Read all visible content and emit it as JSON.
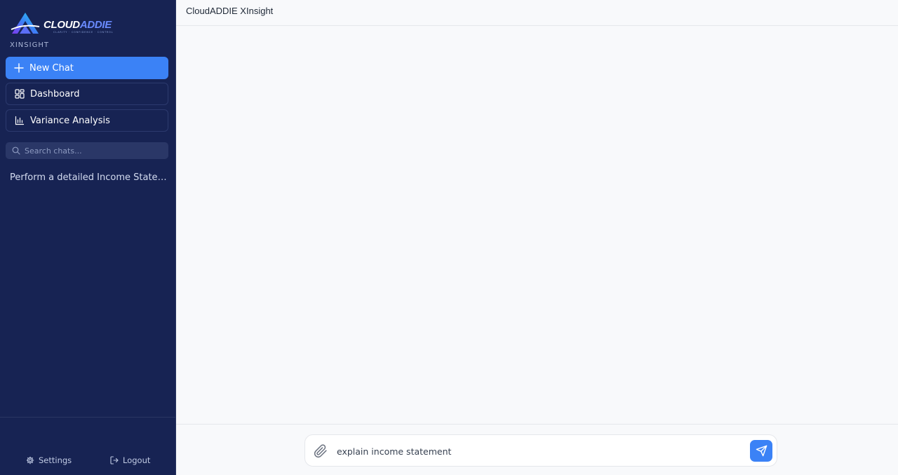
{
  "brand": {
    "logo_text_main": "CLOUD",
    "logo_text_accent": "ADDIE",
    "logo_tagline": "CLARITY · CONFIDENCE · CONTROL",
    "subtitle": "XINSIGHT"
  },
  "sidebar": {
    "new_chat_label": "New Chat",
    "dashboard_label": "Dashboard",
    "variance_label": "Variance Analysis",
    "search_placeholder": "Search chats...",
    "history": [
      "Perform a detailed Income Statement analysis"
    ],
    "settings_label": "Settings",
    "logout_label": "Logout"
  },
  "header": {
    "title": "CloudADDIE XInsight"
  },
  "composer": {
    "value": "explain income statement"
  },
  "colors": {
    "sidebar_bg": "#172353",
    "accent": "#3b82f6",
    "main_bg": "#f8f9fb"
  }
}
